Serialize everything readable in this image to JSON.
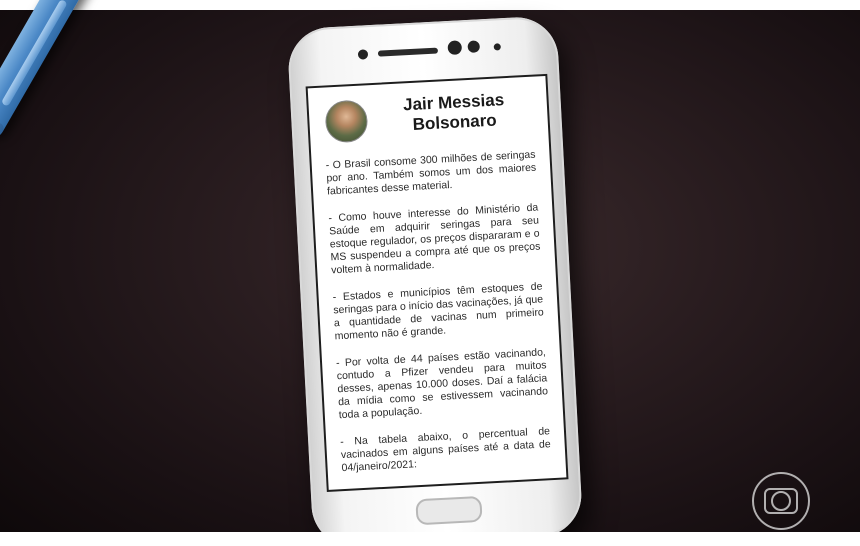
{
  "post": {
    "author": "Jair Messias Bolsonaro",
    "paragraphs": [
      "- O Brasil consome 300 milhões de seringas por ano. Também somos um dos maiores fabricantes desse material.",
      "- Como houve interesse do Ministério da Saúde em adquirir seringas para seu estoque regulador, os preços dispararam e o MS suspendeu a compra até que os preços voltem à normalidade.",
      "- Estados e municípios têm estoques de seringas para o início das vacinações, já que a quantidade de vacinas num primeiro momento não é grande.",
      "- Por volta de 44 países estão vacinando, contudo a Pfizer vendeu para muitos desses, apenas 10.000 doses. Daí a falácia da mídia como se estivessem vacinando toda a população.",
      "- Na tabela abaixo, o percentual de vacinados em alguns países até a data de 04/janeiro/2021:"
    ]
  },
  "colors": {
    "background": "#2a1d20",
    "pen": "#4b88c6",
    "phone_body": "#f4f4f4"
  },
  "icons": {
    "broadcaster_logo": "globo-logo-icon",
    "avatar": "profile-photo"
  }
}
